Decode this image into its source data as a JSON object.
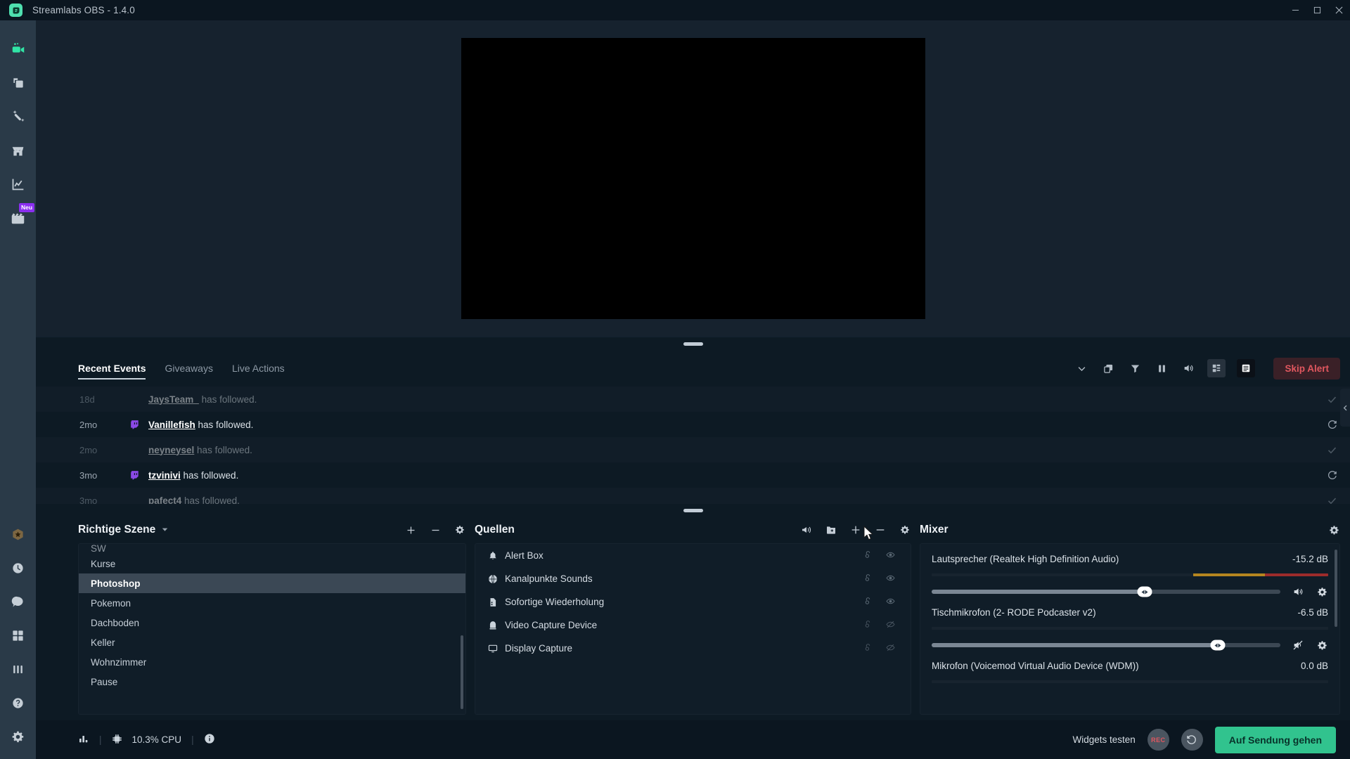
{
  "titlebar": {
    "app_title": "Streamlabs OBS - 1.4.0",
    "logo_icon": "streamlabs-logo-icon",
    "minimize_label": "—",
    "maximize_label": "☐",
    "close_label": "✕"
  },
  "nav": {
    "top_items": [
      {
        "name": "editor",
        "icon": "video-camera-icon",
        "active": true,
        "badge": ""
      },
      {
        "name": "themes",
        "icon": "copy-layers-icon",
        "active": false,
        "badge": ""
      },
      {
        "name": "alert-box",
        "icon": "magic-wand-icon",
        "active": false,
        "badge": ""
      },
      {
        "name": "store",
        "icon": "store-front-icon",
        "active": false,
        "badge": ""
      },
      {
        "name": "dashboard",
        "icon": "line-chart-icon",
        "active": false,
        "badge": ""
      },
      {
        "name": "highlighter",
        "icon": "film-clapper-icon",
        "active": false,
        "badge": "Neu"
      }
    ],
    "bottom_items": [
      {
        "name": "prime",
        "icon": "prime-star-icon",
        "gold": true
      },
      {
        "name": "recent",
        "icon": "clock-icon",
        "gold": false
      },
      {
        "name": "chat",
        "icon": "chat-bubble-icon",
        "gold": false
      },
      {
        "name": "layout-editor",
        "icon": "grid-squares-icon",
        "gold": false
      },
      {
        "name": "stats",
        "icon": "bars-icon",
        "gold": false
      },
      {
        "name": "help",
        "icon": "question-circle-icon",
        "gold": false
      },
      {
        "name": "settings",
        "icon": "gear-icon",
        "gold": false
      }
    ]
  },
  "events": {
    "tabs": [
      {
        "label": "Recent Events",
        "active": true
      },
      {
        "label": "Giveaways",
        "active": false
      },
      {
        "label": "Live Actions",
        "active": false
      }
    ],
    "toolbar_icons": [
      {
        "name": "chevron-down-icon",
        "glyph": "chevron-down",
        "style": "plain"
      },
      {
        "name": "popout-window-icon",
        "glyph": "copy",
        "style": "plain"
      },
      {
        "name": "filter-icon",
        "glyph": "funnel",
        "style": "plain"
      },
      {
        "name": "pause-icon",
        "glyph": "pause",
        "style": "plain"
      },
      {
        "name": "sound-icon",
        "glyph": "speaker",
        "style": "plain"
      },
      {
        "name": "compact-view-icon",
        "glyph": "layout-compact",
        "style": "boxed"
      },
      {
        "name": "list-view-icon",
        "glyph": "layout-list",
        "style": "boxed-dark"
      }
    ],
    "skip_alert_label": "Skip Alert",
    "rows": [
      {
        "time": "18d",
        "platform": "",
        "user": "JaysTeam_",
        "action": " has followed.",
        "alt": true,
        "faded": true,
        "right_icon": "check-icon"
      },
      {
        "time": "2mo",
        "platform": "twitch",
        "user": "Vanillefish",
        "action": " has followed.",
        "alt": false,
        "faded": false,
        "right_icon": "replay-icon"
      },
      {
        "time": "2mo",
        "platform": "",
        "user": "neyneysel",
        "action": " has followed.",
        "alt": true,
        "faded": true,
        "right_icon": "check-icon"
      },
      {
        "time": "3mo",
        "platform": "twitch",
        "user": "tzvinivi",
        "action": " has followed.",
        "alt": false,
        "faded": false,
        "right_icon": "replay-icon"
      },
      {
        "time": "3mo",
        "platform": "",
        "user": "pafect4",
        "action": " has followed.",
        "alt": true,
        "faded": true,
        "right_icon": "check-icon"
      }
    ]
  },
  "scenes": {
    "title": "Richtige Szene",
    "dropdown_icon": "chevron-down-icon",
    "tools": [
      {
        "name": "add-scene-button",
        "icon": "plus-icon"
      },
      {
        "name": "remove-scene-button",
        "icon": "minus-icon"
      },
      {
        "name": "scene-settings-button",
        "icon": "gear-icon"
      }
    ],
    "items": [
      {
        "label": "SW",
        "selected": false,
        "clipped": true
      },
      {
        "label": "Kurse",
        "selected": false,
        "clipped": false
      },
      {
        "label": "Photoshop",
        "selected": true,
        "clipped": false
      },
      {
        "label": "Pokemon",
        "selected": false,
        "clipped": false
      },
      {
        "label": "Dachboden",
        "selected": false,
        "clipped": false
      },
      {
        "label": "Keller",
        "selected": false,
        "clipped": false
      },
      {
        "label": "Wohnzimmer",
        "selected": false,
        "clipped": false
      },
      {
        "label": "Pause",
        "selected": false,
        "clipped": false
      }
    ]
  },
  "sources": {
    "title": "Quellen",
    "tools": [
      {
        "name": "audio-mixer-button",
        "icon": "megaphone-icon"
      },
      {
        "name": "add-folder-button",
        "icon": "folder-plus-icon"
      },
      {
        "name": "add-source-button",
        "icon": "plus-icon"
      },
      {
        "name": "remove-source-button",
        "icon": "minus-icon"
      },
      {
        "name": "source-settings-button",
        "icon": "gear-icon"
      }
    ],
    "items": [
      {
        "label": "Alert Box",
        "icon": "bell-icon",
        "locked": false,
        "visible": true
      },
      {
        "label": "Kanalpunkte Sounds",
        "icon": "globe-icon",
        "locked": false,
        "visible": true
      },
      {
        "label": "Sofortige Wiederholung",
        "icon": "media-file-icon",
        "locked": false,
        "visible": true
      },
      {
        "label": "Video Capture Device",
        "icon": "webcam-icon",
        "locked": false,
        "visible": false
      },
      {
        "label": "Display Capture",
        "icon": "monitor-icon",
        "locked": false,
        "visible": false
      }
    ]
  },
  "mixer": {
    "title": "Mixer",
    "settings_icon": "gear-icon",
    "channels": [
      {
        "name": "Lautsprecher (Realtek High Definition Audio)",
        "db": "-15.2 dB",
        "volume_pct": 61,
        "muted": false,
        "meter": {
          "green_pct": 0,
          "yellow_start_pct": 66,
          "yellow_end_pct": 84,
          "red_end_pct": 100
        }
      },
      {
        "name": "Tischmikrofon (2- RODE Podcaster v2)",
        "db": "-6.5 dB",
        "volume_pct": 82,
        "muted": true,
        "meter": {
          "green_pct": 0,
          "yellow_start_pct": 0,
          "yellow_end_pct": 0,
          "red_end_pct": 0
        }
      },
      {
        "name": "Mikrofon (Voicemod Virtual Audio Device (WDM))",
        "db": "0.0 dB",
        "volume_pct": 0,
        "muted": false,
        "meter": {
          "green_pct": 0,
          "yellow_start_pct": 0,
          "yellow_end_pct": 0,
          "red_end_pct": 0
        }
      }
    ]
  },
  "status": {
    "performance_icon": "bars-chart-icon",
    "cpu_icon": "cpu-chip-icon",
    "cpu_label": "10.3% CPU",
    "info_icon": "info-circle-icon",
    "widgets_test_label": "Widgets testen",
    "record_label": "REC",
    "replay_icon": "replay-buffer-icon",
    "go_live_label": "Auf Sendung gehen"
  },
  "right_panel": {
    "collapse_icon": "chevron-left-icon"
  }
}
